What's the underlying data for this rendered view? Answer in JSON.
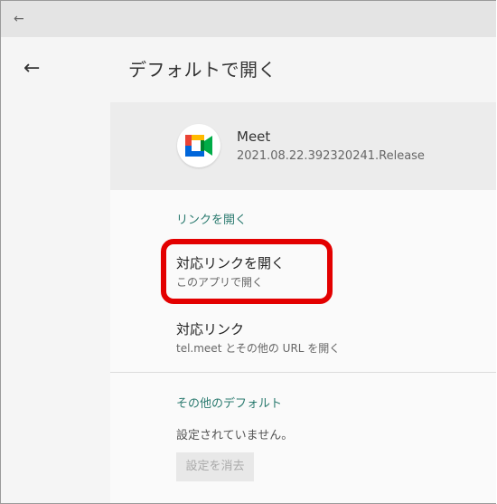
{
  "topbar": {
    "back_icon": "arrow-left-icon"
  },
  "header": {
    "back_icon": "arrow-left-icon",
    "title": "デフォルトで開く"
  },
  "app": {
    "name": "Meet",
    "version": "2021.08.22.392320241.Release",
    "icon": "google-meet-icon"
  },
  "links_section": {
    "label": "リンクを開く",
    "open_supported": {
      "title": "対応リンクを開く",
      "subtitle": "このアプリで開く"
    },
    "supported_links": {
      "title": "対応リンク",
      "subtitle": "tel.meet とその他の URL を開く"
    }
  },
  "other_defaults": {
    "label": "その他のデフォルト",
    "status": "設定されていません。",
    "clear_button": "設定を消去"
  },
  "colors": {
    "accent": "#2a7a6f",
    "highlight": "#e30000",
    "meet_green": "#00832d",
    "meet_blue": "#0066da",
    "meet_yellow": "#ffba00",
    "meet_red": "#ea4335"
  }
}
